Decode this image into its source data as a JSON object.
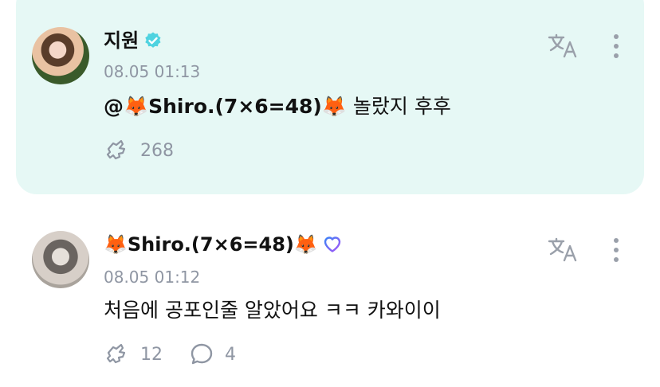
{
  "post": {
    "author": "지원",
    "timestamp": "08.05 01:13",
    "mention": "@🦊Shiro.(7×6=48)🦊",
    "text": " 놀랐지 후후",
    "like_count": "268",
    "accent": "#e6f8f5"
  },
  "reply": {
    "author": "🦊Shiro.(7×6=48)🦊",
    "timestamp": "08.05 01:12",
    "text": "처음에 공포인줄 알았어요 ㅋㅋ 카와이이",
    "like_count": "12",
    "comment_count": "4"
  },
  "icons": {
    "verified": "verified-check-icon",
    "heart": "heart-outline-icon",
    "translate": "translate-icon",
    "like": "like-icon",
    "comment": "comment-icon",
    "more": "more-vertical-icon"
  },
  "colors": {
    "verified": "#4fd3e0",
    "heart_start": "#3b82f6",
    "heart_end": "#a855f7",
    "muted": "#8f96a3"
  }
}
